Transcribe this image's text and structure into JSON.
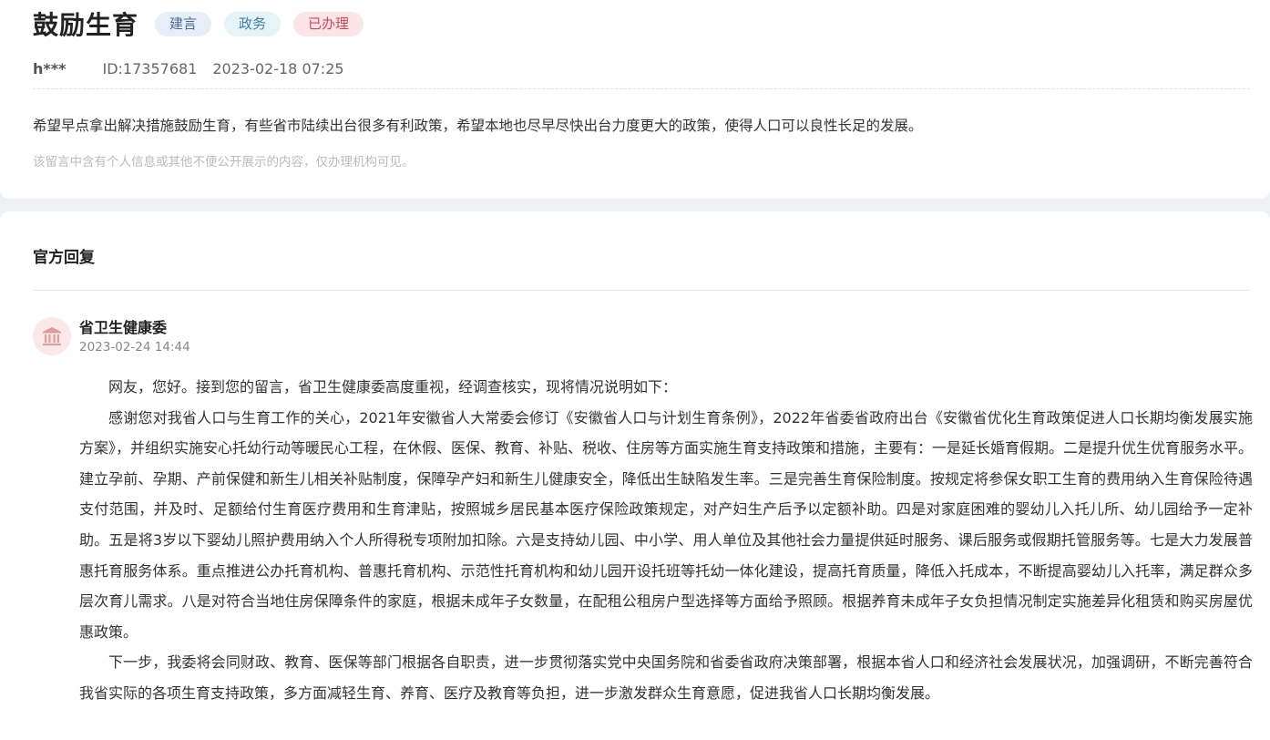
{
  "post": {
    "title": "鼓励生育",
    "tags": [
      "建言",
      "政务",
      "已办理"
    ],
    "user": "h***",
    "id_text": "ID:17357681",
    "datetime": "2023-02-18 07:25",
    "content": "希望早点拿出解决措施鼓励生育，有些省市陆续出台很多有利政策，希望本地也尽早尽快出台力度更大的政策，使得人口可以良性长足的发展。",
    "privacy_notice": "该留言中含有个人信息或其他不便公开展示的内容，仅办理机构可见。"
  },
  "reply": {
    "heading": "官方回复",
    "org_icon": "government-building-icon",
    "org_name": "省卫生健康委",
    "date": "2023-02-24 14:44",
    "paragraphs": [
      "网友，您好。接到您的留言，省卫生健康委高度重视，经调查核实，现将情况说明如下：",
      "感谢您对我省人口与生育工作的关心，2021年安徽省人大常委会修订《安徽省人口与计划生育条例》，2022年省委省政府出台《安徽省优化生育政策促进人口长期均衡发展实施方案》，并组织实施安心托幼行动等暖民心工程，在休假、医保、教育、补贴、税收、住房等方面实施生育支持政策和措施，主要有：一是延长婚育假期。二是提升优生优育服务水平。建立孕前、孕期、产前保健和新生儿相关补贴制度，保障孕产妇和新生儿健康安全，降低出生缺陷发生率。三是完善生育保险制度。按规定将参保女职工生育的费用纳入生育保险待遇支付范围，并及时、足额给付生育医疗费用和生育津贴，按照城乡居民基本医疗保险政策规定，对产妇生产后予以定额补助。四是对家庭困难的婴幼儿入托儿所、幼儿园给予一定补助。五是将3岁以下婴幼儿照护费用纳入个人所得税专项附加扣除。六是支持幼儿园、中小学、用人单位及其他社会力量提供延时服务、课后服务或假期托管服务等。七是大力发展普惠托育服务体系。重点推进公办托育机构、普惠托育机构、示范性托育机构和幼儿园开设托班等托幼一体化建设，提高托育质量，降低入托成本，不断提高婴幼儿入托率，满足群众多层次育儿需求。八是对符合当地住房保障条件的家庭，根据未成年子女数量，在配租公租房户型选择等方面给予照顾。根据养育未成年子女负担情况制定实施差异化租赁和购买房屋优惠政策。",
      "下一步，我委将会同财政、教育、医保等部门根据各自职责，进一步贯彻落实党中央国务院和省委省政府决策部署，根据本省人口和经济社会发展状况，加强调研，不断完善符合我省实际的各项生育支持政策，多方面减轻生育、养育、医疗及教育等负担，进一步激发群众生育意愿，促进我省人口长期均衡发展。"
    ]
  },
  "colors": {
    "page_bg": "#eef0f3",
    "card_bg": "#ffffff",
    "tag_suggest": "#4a6a96",
    "tag_gov": "#3d7fa8",
    "tag_done": "#d54654",
    "avatar_bg": "#fbe8e8",
    "avatar_icon": "#e49a9a"
  }
}
